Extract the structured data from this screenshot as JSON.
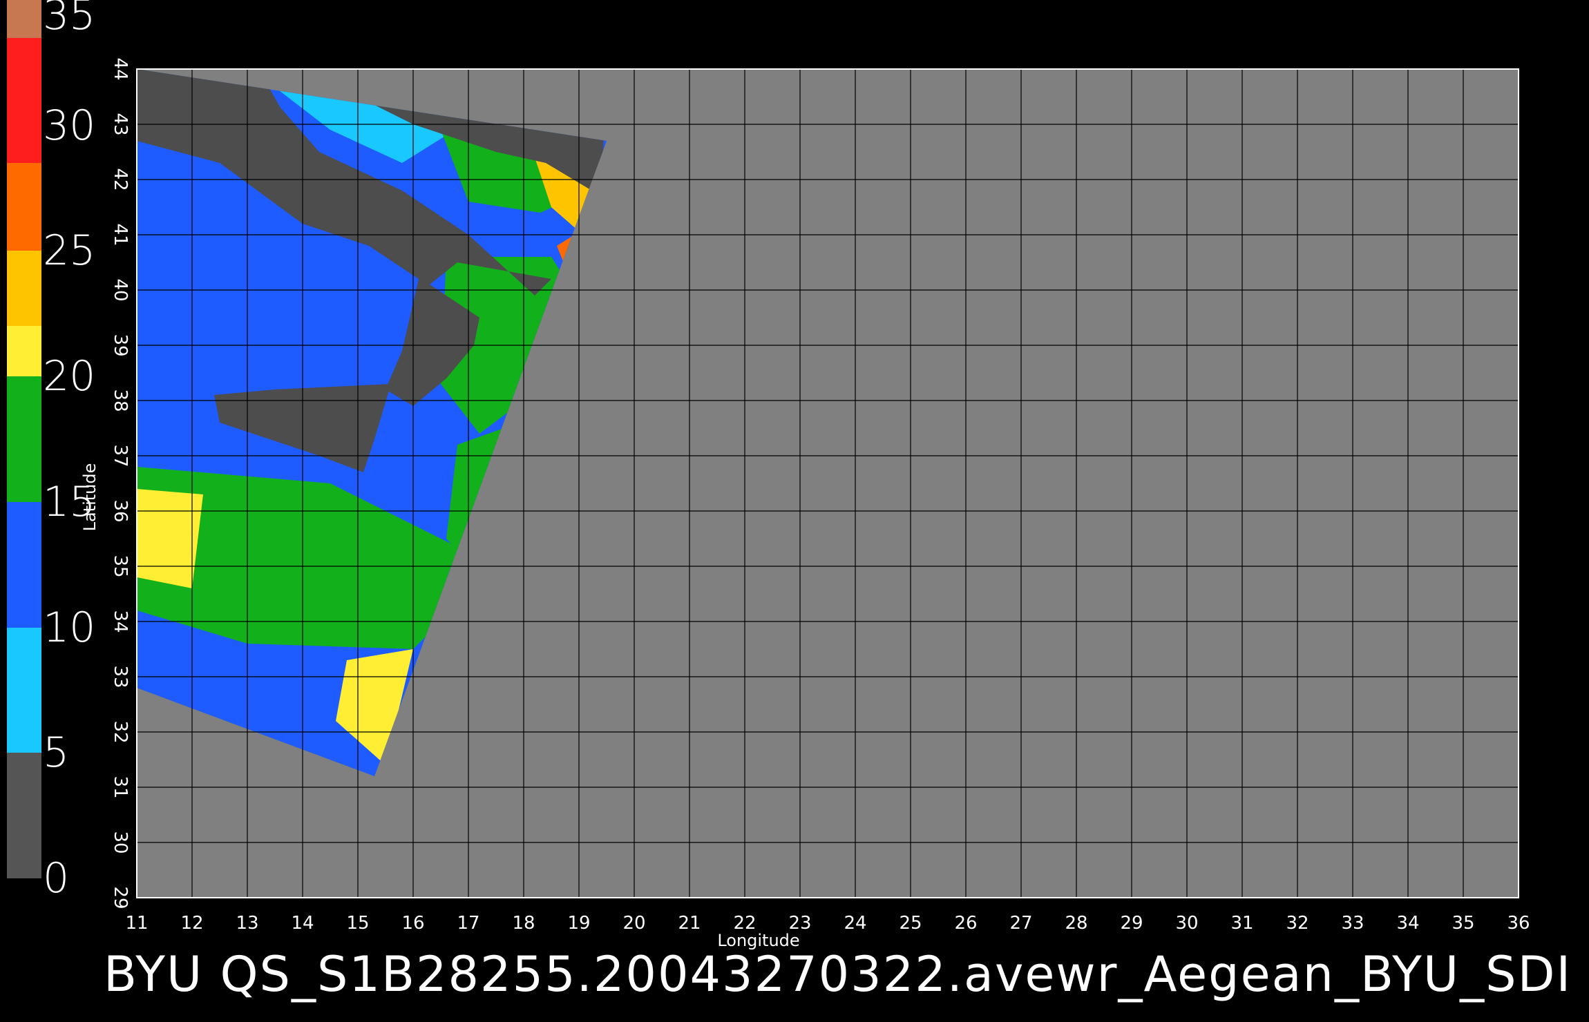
{
  "colorbar": {
    "labels": [
      "35",
      "30",
      "25",
      "20",
      "15",
      "10",
      "5",
      "0"
    ],
    "segments": [
      {
        "from": 35,
        "to": 33.5,
        "color": "#c87850"
      },
      {
        "from": 33.5,
        "to": 28.5,
        "color": "#ff1e1e"
      },
      {
        "from": 28.5,
        "to": 25,
        "color": "#ff6a00"
      },
      {
        "from": 25,
        "to": 22,
        "color": "#ffc400"
      },
      {
        "from": 22,
        "to": 20,
        "color": "#ffee33"
      },
      {
        "from": 20,
        "to": 15,
        "color": "#12b01a"
      },
      {
        "from": 15,
        "to": 10,
        "color": "#1e5cff"
      },
      {
        "from": 10,
        "to": 5,
        "color": "#19c8ff"
      },
      {
        "from": 5,
        "to": 0,
        "color": "#555555"
      }
    ]
  },
  "map": {
    "background_color": "#808080",
    "land_color": "#4d4d4d",
    "grid_color": "#000000",
    "x_label": "Longitude",
    "y_label": "Latitude",
    "lon_ticks": [
      "11",
      "12",
      "13",
      "14",
      "15",
      "16",
      "17",
      "18",
      "19",
      "20",
      "21",
      "22",
      "23",
      "24",
      "25",
      "26",
      "27",
      "28",
      "29",
      "30",
      "31",
      "32",
      "33",
      "34",
      "35",
      "36"
    ],
    "lat_ticks": [
      "29",
      "30",
      "31",
      "32",
      "33",
      "34",
      "35",
      "36",
      "37",
      "38",
      "39",
      "40",
      "41",
      "42",
      "43",
      "44"
    ],
    "lon_range": [
      11,
      36
    ],
    "lat_range": [
      29,
      44
    ]
  },
  "footer": {
    "text": "BYU  QS_S1B28255.20043270322.avewr_Aegean_BYU_SDI"
  }
}
